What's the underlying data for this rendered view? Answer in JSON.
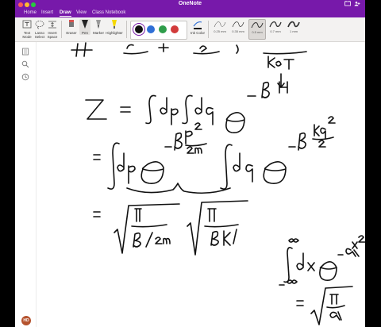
{
  "window": {
    "title": "OneNote"
  },
  "tabs": [
    {
      "label": "Home",
      "active": false
    },
    {
      "label": "Insert",
      "active": false
    },
    {
      "label": "Draw",
      "active": true
    },
    {
      "label": "View",
      "active": false
    },
    {
      "label": "Class Notebook",
      "active": false
    }
  ],
  "ribbon": {
    "text_mode": "Text Mode",
    "lasso_select": "Lasso Select",
    "insert_space": "Insert Space",
    "eraser": "Eraser",
    "pen": "Pen",
    "marker": "Marker",
    "highlighter": "Highlighter",
    "ink_color": "Ink Color",
    "thickness": [
      "0.25 mm",
      "0.35 mm",
      "0.5 mm",
      "0.7 mm",
      "1 mm"
    ],
    "selected_thickness": "0.5 mm"
  },
  "colors": {
    "accent": "#7719AA",
    "swatches": [
      "#111111",
      "#2f6fd6",
      "#2e9d4a",
      "#d23b3b"
    ]
  },
  "user": {
    "initials": "HD"
  }
}
